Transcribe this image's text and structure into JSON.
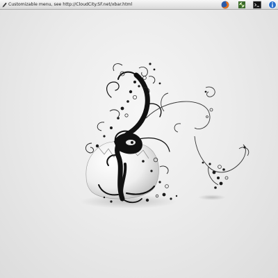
{
  "topbar": {
    "menu_text": "Customizable menu, see http://CloudCity.SF.net/xbar.html",
    "tray_icons": [
      "firefox-icon",
      "network-transfer-icon",
      "terminal-icon",
      "info-icon"
    ]
  },
  "colors": {
    "bar_top": "#f7f7f7",
    "bar_bottom": "#d9d9d9",
    "firefox_orange": "#e8731e",
    "firefox_blue": "#2a5aa8",
    "info_blue": "#2b6fc9"
  }
}
